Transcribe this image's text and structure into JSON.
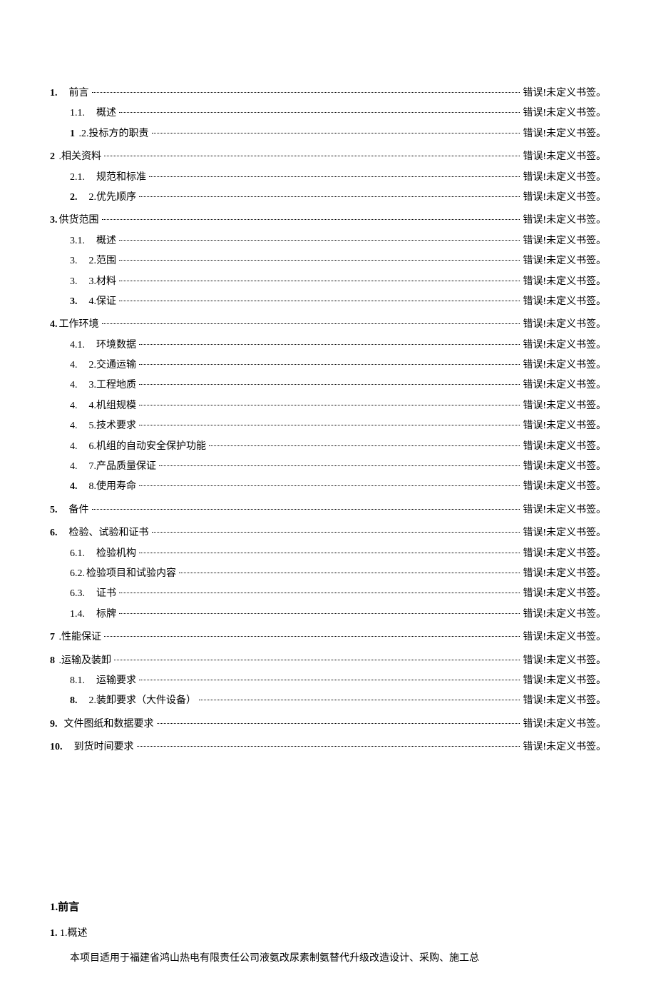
{
  "error_text": "错误!未定义书签。",
  "toc": [
    {
      "level": 0,
      "num": "1.",
      "title": "前言",
      "boldNum": true,
      "gap": "    "
    },
    {
      "level": 1,
      "num": "1.1.",
      "title": "概述",
      "boldNum": false,
      "gap": "    "
    },
    {
      "level": 1,
      "num": "1",
      "title": ".2.投标方的职责",
      "boldNum": true,
      "gap": " "
    },
    {
      "level": 0,
      "num": "2",
      "title": ".相关资料",
      "boldNum": true,
      "gap": " "
    },
    {
      "level": 1,
      "num": "2.1.",
      "title": "规范和标准",
      "boldNum": false,
      "gap": "    "
    },
    {
      "level": 1,
      "num": "2.",
      "title": "2.优先顺序",
      "boldNum": true,
      "gap": "    "
    },
    {
      "level": 0,
      "num": "3.",
      "title": "供货范围",
      "boldNum": true,
      "gap": ""
    },
    {
      "level": 1,
      "num": "3.1.",
      "title": "概述",
      "boldNum": false,
      "gap": "    "
    },
    {
      "level": 1,
      "num": "3.",
      "title": "2.范围",
      "boldNum": false,
      "gap": "    "
    },
    {
      "level": 1,
      "num": "3.",
      "title": "3.材料",
      "boldNum": false,
      "gap": "    "
    },
    {
      "level": 1,
      "num": "3.",
      "title": "4.保证",
      "boldNum": true,
      "gap": "    "
    },
    {
      "level": 0,
      "num": "4.",
      "title": "工作环境",
      "boldNum": true,
      "gap": ""
    },
    {
      "level": 1,
      "num": "4.1.",
      "title": "环境数据",
      "boldNum": false,
      "gap": "    "
    },
    {
      "level": 1,
      "num": "4.",
      "title": "2.交通运输",
      "boldNum": false,
      "gap": "    "
    },
    {
      "level": 1,
      "num": "4.",
      "title": "3.工程地质",
      "boldNum": false,
      "gap": "    "
    },
    {
      "level": 1,
      "num": "4.",
      "title": "4.机组规模",
      "boldNum": false,
      "gap": "    "
    },
    {
      "level": 1,
      "num": "4.",
      "title": "5.技术要求",
      "boldNum": false,
      "gap": "    "
    },
    {
      "level": 1,
      "num": "4.",
      "title": "6.机组的自动安全保护功能",
      "boldNum": false,
      "gap": "    "
    },
    {
      "level": 1,
      "num": "4.",
      "title": "7.产品质量保证",
      "boldNum": false,
      "gap": "    "
    },
    {
      "level": 1,
      "num": "4.",
      "title": "8.使用寿命",
      "boldNum": true,
      "gap": "    "
    },
    {
      "level": 0,
      "num": "5.",
      "title": "备件",
      "boldNum": true,
      "gap": "    "
    },
    {
      "level": 0,
      "num": "6.",
      "title": "检验、试验和证书",
      "boldNum": true,
      "gap": "    "
    },
    {
      "level": 1,
      "num": "6.1.",
      "title": "检验机构",
      "boldNum": false,
      "gap": "    "
    },
    {
      "level": 1,
      "num": "6.2.",
      "title": "检验项目和试验内容",
      "boldNum": false,
      "gap": ""
    },
    {
      "level": 1,
      "num": "6.3.",
      "title": "证书",
      "boldNum": false,
      "gap": "    "
    },
    {
      "level": 1,
      "num": "1.4.",
      "title": "标牌",
      "boldNum": false,
      "gap": "    "
    },
    {
      "level": 0,
      "num": "7",
      "title": ".性能保证",
      "boldNum": true,
      "gap": " "
    },
    {
      "level": 0,
      "num": "8",
      "title": ".运输及装卸",
      "boldNum": true,
      "gap": " "
    },
    {
      "level": 1,
      "num": "8.1.",
      "title": "运输要求",
      "boldNum": false,
      "gap": "    "
    },
    {
      "level": 1,
      "num": "8.",
      "title": "2.装卸要求（大件设备）",
      "boldNum": true,
      "gap": "    "
    },
    {
      "level": 0,
      "num": "9.",
      "title": "文件图纸和数据要求",
      "boldNum": true,
      "gap": "  "
    },
    {
      "level": 0,
      "num": "10.",
      "title": "到货时间要求",
      "boldNum": true,
      "gap": "    "
    }
  ],
  "body": {
    "heading1": "1.前言",
    "heading2_num": "1.",
    "heading2_rest": " 1.概述",
    "paragraph1": "本项目适用于福建省鸿山热电有限责任公司液氨改尿素制氨替代升级改造设计、采购、施工总"
  }
}
